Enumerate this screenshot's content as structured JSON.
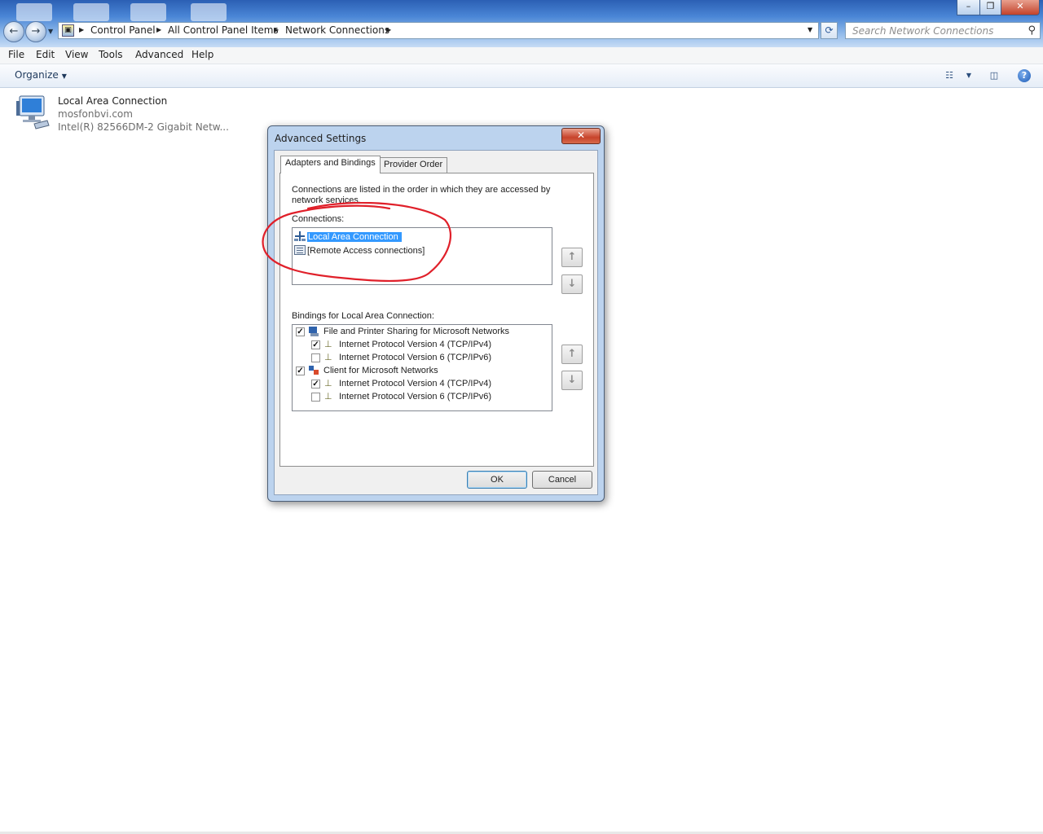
{
  "window": {
    "minimize_label": "–",
    "maximize_label": "❐",
    "close_label": "✕"
  },
  "address": {
    "crumbs": [
      "Control Panel",
      "All Control Panel Items",
      "Network Connections"
    ]
  },
  "search": {
    "placeholder": "Search Network Connections"
  },
  "menu": {
    "items": [
      "File",
      "Edit",
      "View",
      "Tools",
      "Advanced",
      "Help"
    ]
  },
  "command_bar": {
    "organize_label": "Organize",
    "help_label": "?"
  },
  "connection_item": {
    "title": "Local Area Connection",
    "network": "mosfonbvi.com",
    "adapter": "Intel(R) 82566DM-2 Gigabit Netw..."
  },
  "dialog": {
    "title": "Advanced Settings",
    "close_label": "✕",
    "tabs": [
      "Adapters and Bindings",
      "Provider Order"
    ],
    "description": "Connections are listed in the order in which they are accessed by network services.",
    "connections_label": "Connections:",
    "connections": [
      "Local Area Connection",
      "[Remote Access connections]"
    ],
    "bindings_label": "Bindings for Local Area Connection:",
    "bindings": [
      {
        "label": "File and Printer Sharing for Microsoft Networks",
        "checked": true,
        "level": 0
      },
      {
        "label": "Internet Protocol Version 4 (TCP/IPv4)",
        "checked": true,
        "level": 1
      },
      {
        "label": "Internet Protocol Version 6 (TCP/IPv6)",
        "checked": false,
        "level": 1
      },
      {
        "label": "Client for Microsoft Networks",
        "checked": true,
        "level": 0
      },
      {
        "label": "Internet Protocol Version 4 (TCP/IPv4)",
        "checked": true,
        "level": 1
      },
      {
        "label": "Internet Protocol Version 6 (TCP/IPv6)",
        "checked": false,
        "level": 1
      }
    ],
    "up_arrow": "↑",
    "down_arrow": "↓",
    "ok_label": "OK",
    "cancel_label": "Cancel"
  },
  "colors": {
    "selection": "#3399ff",
    "annotation_circle": "#e0202a",
    "title_bar": "#4a86d6"
  }
}
